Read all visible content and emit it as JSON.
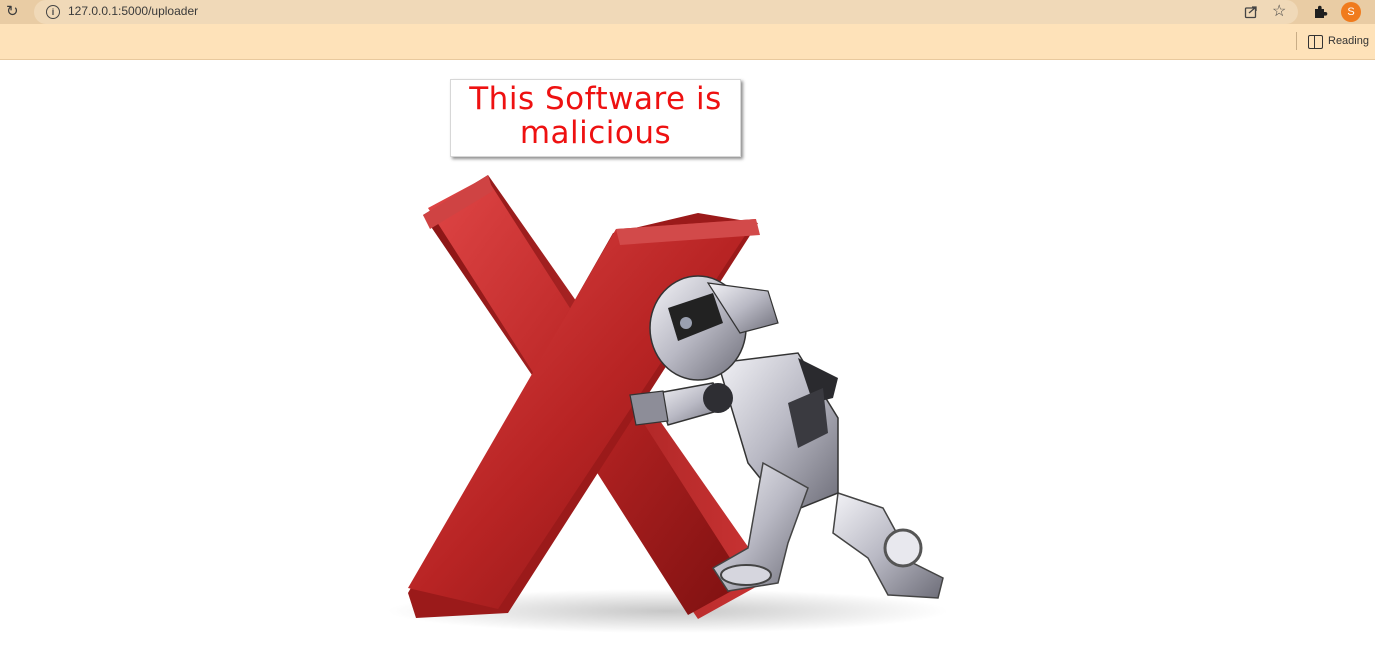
{
  "browser": {
    "url": "127.0.0.1:5000/uploader",
    "profile_initial": "S",
    "reading_label": "Reading",
    "icons": [
      "reload-icon",
      "info-icon",
      "share-icon",
      "star-icon",
      "extensions-icon",
      "reading-list-icon"
    ],
    "colors": {
      "toolbar": "#e9cca4",
      "bookmarks_bar": "#fee2b9",
      "avatar": "#f07b1d"
    }
  },
  "page": {
    "banner_text": "This Software is malicious",
    "banner_color": "#ee1111",
    "image": "red-x-with-robot-pushing"
  }
}
